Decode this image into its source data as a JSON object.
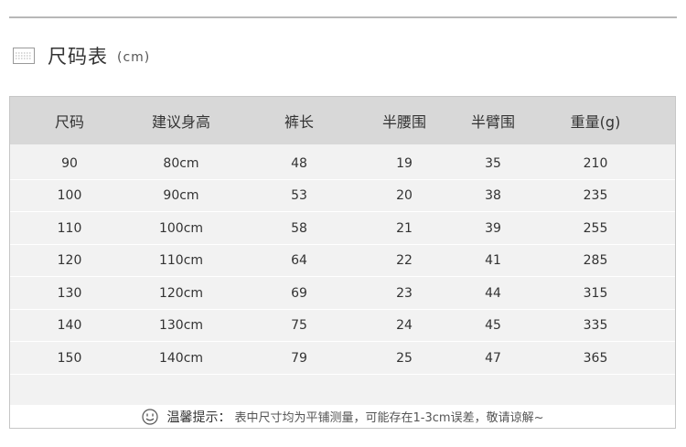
{
  "title": "尺码表",
  "unit": "(cm)",
  "table": {
    "columns": [
      "尺码",
      "建议身高",
      "裤长",
      "半腰围",
      "半臂围",
      "重量(g)"
    ],
    "rows": [
      [
        "90",
        "80cm",
        "48",
        "19",
        "35",
        "210"
      ],
      [
        "100",
        "90cm",
        "53",
        "20",
        "38",
        "235"
      ],
      [
        "110",
        "100cm",
        "58",
        "21",
        "39",
        "255"
      ],
      [
        "120",
        "110cm",
        "64",
        "22",
        "41",
        "285"
      ],
      [
        "130",
        "120cm",
        "69",
        "23",
        "44",
        "315"
      ],
      [
        "140",
        "130cm",
        "75",
        "24",
        "45",
        "335"
      ],
      [
        "150",
        "140cm",
        "79",
        "25",
        "47",
        "365"
      ]
    ]
  },
  "footer": {
    "label": "温馨提示：",
    "note": "表中尺寸均为平铺测量，可能存在1-3cm误差，敬请谅解~"
  }
}
